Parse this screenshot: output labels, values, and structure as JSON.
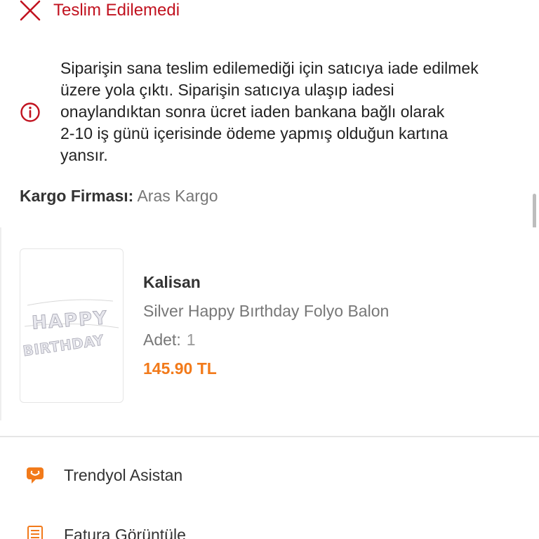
{
  "status": {
    "text": "Teslim Edilemedi",
    "icon": "close-icon",
    "color": "#c1121f"
  },
  "info": {
    "icon": "info-icon",
    "lines": [
      "Siparişin sana teslim edilemediği için satıcıya iade edilmek",
      "üzere yola çıktı. Siparişin satıcıya ulaşıp iadesi",
      "onaylandıktan sonra ücret iaden bankana bağlı olarak",
      "2-10 iş günü içerisinde ödeme yapmış olduğun kartına",
      "yansır."
    ]
  },
  "cargo": {
    "label": "Kargo Firması:",
    "value": "Aras Kargo"
  },
  "product": {
    "image_text_line1": "HAPPY",
    "image_text_line2": "BIRTHDAY",
    "seller": "Kalisan",
    "name": "Silver Happy Bırthday Folyo Balon",
    "quantity_label": "Adet:",
    "quantity_value": "1",
    "price": "145.90 TL",
    "price_color": "#f27a1a"
  },
  "menu": {
    "items": [
      {
        "label": "Trendyol Asistan",
        "icon": "assistant-chat-icon"
      },
      {
        "label": "Fatura Görüntüle",
        "icon": "invoice-icon"
      }
    ]
  }
}
